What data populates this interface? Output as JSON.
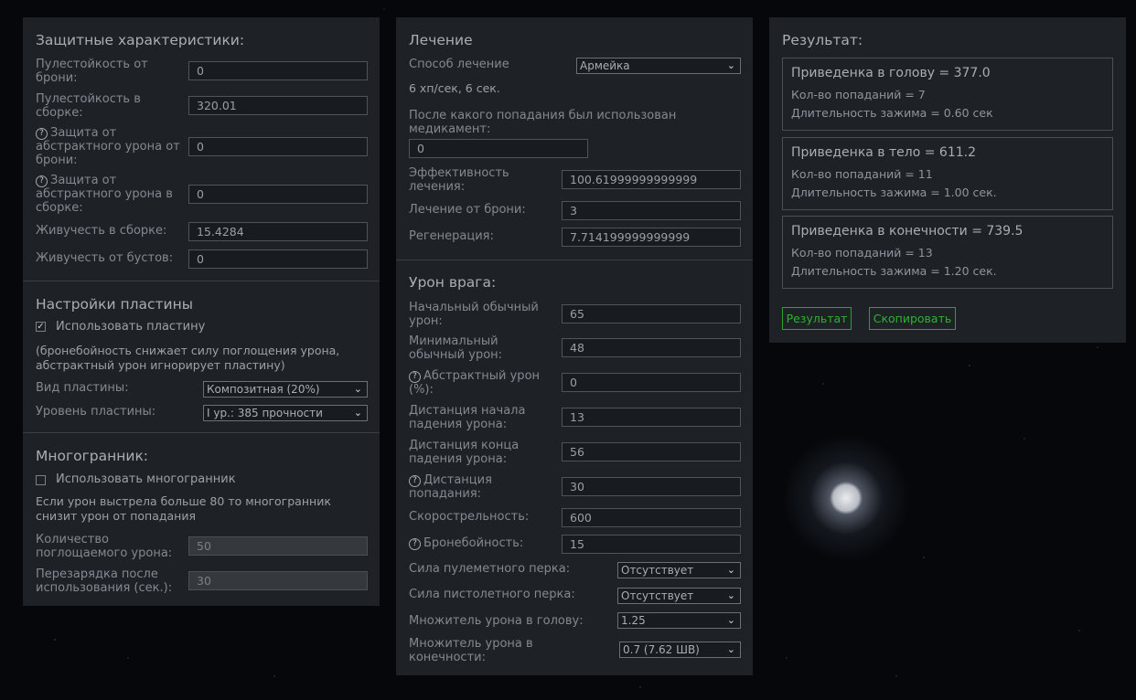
{
  "defense": {
    "title": "Защитные характеристики:",
    "armor_bullet_label": "Пулестойкость от брони:",
    "armor_bullet_value": "0",
    "build_bullet_label": "Пулестойкость в сборке:",
    "build_bullet_value": "320.01",
    "abstract_armor_label": "Защита от абстрактного урона от брони:",
    "abstract_armor_value": "0",
    "abstract_build_label": "Защита от абстрактного урона в сборке:",
    "abstract_build_value": "0",
    "vitality_build_label": "Живучесть в сборке:",
    "vitality_build_value": "15.4284",
    "vitality_boost_label": "Живучесть от бустов:",
    "vitality_boost_value": "0"
  },
  "plate": {
    "title": "Настройки пластины",
    "use_label": "Использовать пластину",
    "use_checked": true,
    "note": "(бронебойность снижает силу поглощения урона, абстрактный урон игнорирует пластину)",
    "type_label": "Вид пластины:",
    "type_value": "Композитная (20%)",
    "level_label": "Уровень пластины:",
    "level_value": "I ур.: 385 прочности"
  },
  "polyhedron": {
    "title": "Многогранник:",
    "use_label": "Использовать многогранник",
    "use_checked": false,
    "note": "Если урон выстрела больше 80 то многогранник снизит урон от попадания",
    "absorb_label": "Количество поглощаемого урона:",
    "absorb_value": "50",
    "cooldown_label": "Перезарядка после использования (сек.):",
    "cooldown_value": "30"
  },
  "healing": {
    "title": "Лечение",
    "method_label": "Способ лечение",
    "method_value": "Армейка",
    "method_info": "6 хп/сек, 6 сек.",
    "after_hit_label": "После какого попадания был использован медикамент:",
    "after_hit_value": "0",
    "efficiency_label": "Эффективность лечения:",
    "efficiency_value": "100.61999999999999",
    "armor_heal_label": "Лечение от брони:",
    "armor_heal_value": "3",
    "regen_label": "Регенерация:",
    "regen_value": "7.714199999999999"
  },
  "enemy": {
    "title": "Урон врага:",
    "base_dmg_label": "Начальный обычный урон:",
    "base_dmg_value": "65",
    "min_dmg_label": "Минимальный обычный урон:",
    "min_dmg_value": "48",
    "abstract_dmg_label": "Абстрактный урон (%):",
    "abstract_dmg_value": "0",
    "falloff_start_label": "Дистанция начала падения урона:",
    "falloff_start_value": "13",
    "falloff_end_label": "Дистанция конца падения урона:",
    "falloff_end_value": "56",
    "hit_distance_label": "Дистанция попадания:",
    "hit_distance_value": "30",
    "fire_rate_label": "Скорострельность:",
    "fire_rate_value": "600",
    "penetration_label": "Бронебойность:",
    "penetration_value": "15",
    "mg_perk_label": "Сила пулеметного перка:",
    "mg_perk_value": "Отсутствует",
    "pistol_perk_label": "Сила пистолетного перка:",
    "pistol_perk_value": "Отсутствует",
    "head_mult_label": "Множитель урона в голову:",
    "head_mult_value": "1.25",
    "limb_mult_label": "Множитель урона в конечности:",
    "limb_mult_value": "0.7 (7.62 ШВ)"
  },
  "result": {
    "title": "Результат:",
    "head_title": "Приведенка в голову = 377.0",
    "head_hits": "Кол-во попаданий = 7",
    "head_duration": "Длительность зажима = 0.60 сек",
    "body_title": "Приведенка в тело = 611.2",
    "body_hits": "Кол-во попаданий = 11",
    "body_duration": "Длительность зажима = 1.00 сек.",
    "limb_title": "Приведенка в конечности = 739.5",
    "limb_hits": "Кол-во попаданий = 13",
    "limb_duration": "Длительность зажима = 1.20 сек.",
    "result_button": "Результат",
    "copy_button": "Скопировать",
    "accent": "#2fb12f"
  },
  "icons": {
    "help": "?",
    "check": "✓",
    "chevron": "⌄"
  }
}
